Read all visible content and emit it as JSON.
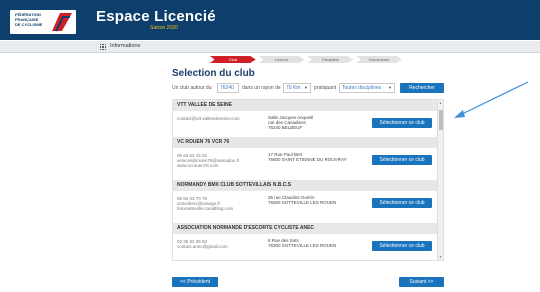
{
  "header": {
    "logo_lines": [
      "FÉDÉRATION",
      "FRANÇAISE",
      "DE CYCLISME"
    ],
    "app_title": "Espace Licencié",
    "app_subtitle": "Saison 2020"
  },
  "subnav": {
    "label": "Informations"
  },
  "steps": [
    {
      "label": "Club",
      "active": true
    },
    {
      "label": "Licence",
      "active": false
    },
    {
      "label": "Discipline",
      "active": false
    },
    {
      "label": "Documents",
      "active": false
    }
  ],
  "page_title": "Selection du club",
  "search": {
    "prefix": "Un club autour du",
    "postal_code": "76240",
    "mid": "dans un rayon de",
    "radius": "70 Km",
    "practice_label": "pratiquant",
    "discipline": "Toutes disciplines",
    "button": "Rechercher"
  },
  "clubs": [
    {
      "name": "VTT VALLEE DE SEINE",
      "contact": [
        "contact@vtt-valleedeseine.com"
      ],
      "address": [
        "Salle Jacques Anquetil",
        "rue des Canadiens",
        "76240 BELBEUF"
      ],
      "button": "Sélectionner ce club"
    },
    {
      "name": "VC ROUEN 76 VCR 76",
      "contact": [
        "06 63 62 15 02",
        "velocelubrouen76@wanadoo.fr",
        "www.vcrouen76.com"
      ],
      "address": [
        "17 Rue Paul Bert",
        "76800 SAINT ETIENNE DU ROUVRAY"
      ],
      "button": "Sélectionner ce club"
    },
    {
      "name": "NORMANDY BMX CLUB SOTTEVILLAIS N.B.C.S",
      "contact": [
        "06 84 03 70 76",
        "actionbmx@orange.fr",
        "bmxsotteville.canalblog.com"
      ],
      "address": [
        "35 rue Claudine Guérin",
        "76300 SOTTEVILLE LES ROUEN"
      ],
      "button": "Sélectionner ce club"
    },
    {
      "name": "ASSOCIATION NORMANDE D'ESCORTE CYCLISTE ANEC",
      "contact": [
        "02 35 62 25 62",
        "contact.anec@gmail.com"
      ],
      "address": [
        "8 Rue des Sots",
        "76300 SOTTEVILLE LES ROUEN"
      ],
      "button": "Sélectionner ce club"
    }
  ],
  "footer": {
    "prev": "<< Précédent",
    "next": "Suivant >>"
  },
  "colors": {
    "topbar": "#0e3e6b",
    "accent": "#1a74bd",
    "step_active": "#d01f26",
    "annotation": "#3f8fd6"
  }
}
